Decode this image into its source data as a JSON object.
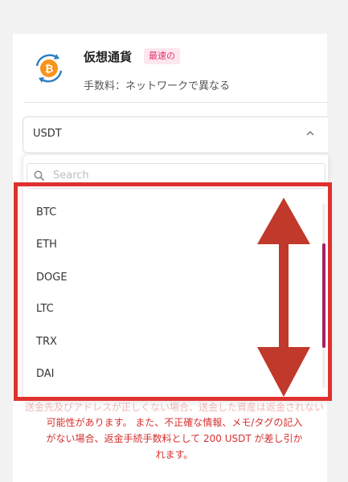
{
  "header": {
    "title": "仮想通貨",
    "badge": "最速の",
    "fee": "手数料：ネットワークで異なる"
  },
  "select": {
    "value": "USDT"
  },
  "dropdown": {
    "search_placeholder": "Search",
    "items": [
      "BTC",
      "ETH",
      "DOGE",
      "LTC",
      "TRX",
      "DAI"
    ]
  },
  "warning": {
    "line0": "送金先及びアドレスが正しくない場合、送金した資産は返金されない",
    "line1": "可能性があります。 また、不正確な情報、メモ/タグの記入",
    "line2": "がない場合、返金手続手数料として 200 USDT が差し引か",
    "line3": "れます。"
  },
  "colors": {
    "accent": "#e0346e",
    "highlight": "#e0312f",
    "arrow": "#c0392b",
    "scrollbar": "#a0216a",
    "warning": "#d63030"
  }
}
